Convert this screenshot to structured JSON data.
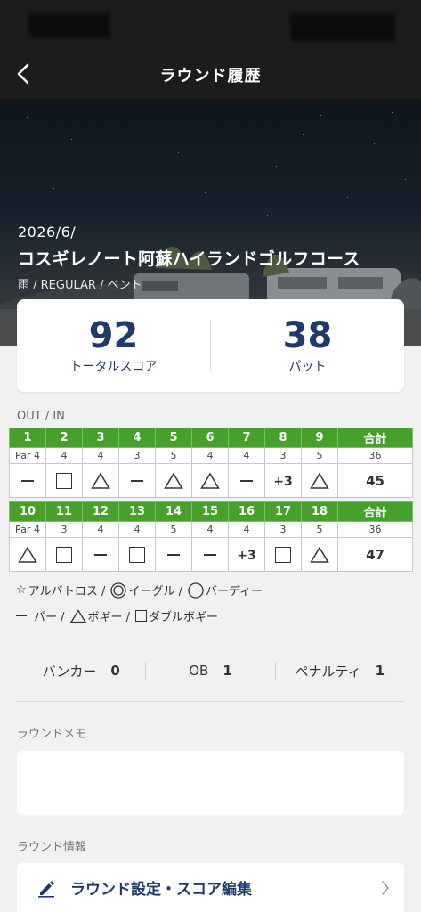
{
  "nav": {
    "title": "ラウンド履歴"
  },
  "round": {
    "date": "2026/6/",
    "course": "コスギレノート阿蘇ハイランドゴルフコース",
    "meta": "雨 / REGULAR / ベント"
  },
  "summary": {
    "total_score": "92",
    "total_label": "トータルスコア",
    "putts": "38",
    "putts_label": "パット"
  },
  "scorecard": {
    "section_label": "OUT / IN",
    "total_header": "合計",
    "out": {
      "holes": [
        "1",
        "2",
        "3",
        "4",
        "5",
        "6",
        "7",
        "8",
        "9"
      ],
      "pars": [
        "Par 4",
        "4",
        "4",
        "3",
        "5",
        "4",
        "4",
        "3",
        "5"
      ],
      "par_total": "36",
      "marks": [
        "dash",
        "square",
        "triangle",
        "dash",
        "triangle",
        "triangle",
        "dash",
        "+3",
        "triangle"
      ],
      "total": "45"
    },
    "in": {
      "holes": [
        "10",
        "11",
        "12",
        "13",
        "14",
        "15",
        "16",
        "17",
        "18"
      ],
      "pars": [
        "Par 4",
        "3",
        "4",
        "4",
        "5",
        "4",
        "4",
        "3",
        "5"
      ],
      "par_total": "36",
      "marks": [
        "triangle",
        "square",
        "dash",
        "square",
        "dash",
        "dash",
        "+3",
        "square",
        "triangle"
      ],
      "total": "47"
    }
  },
  "legend": {
    "albatross": "アルバトロス /",
    "eagle": "イーグル /",
    "birdie": "バーディー",
    "par": "パー /",
    "bogey": "ボギー /",
    "double_bogey": "ダブルボギー"
  },
  "stats": {
    "bunker_label": "バンカー",
    "bunker_value": "0",
    "ob_label": "OB",
    "ob_value": "1",
    "penalty_label": "ペナルティ",
    "penalty_value": "1"
  },
  "memo": {
    "label": "ラウンドメモ",
    "value": ""
  },
  "info": {
    "label": "ラウンド情報",
    "settings_label": "ラウンド設定・スコア編集"
  },
  "colors": {
    "header_green": "#47a02c",
    "navy": "#1f3b6e",
    "nav_bg": "#1c1c1c"
  }
}
